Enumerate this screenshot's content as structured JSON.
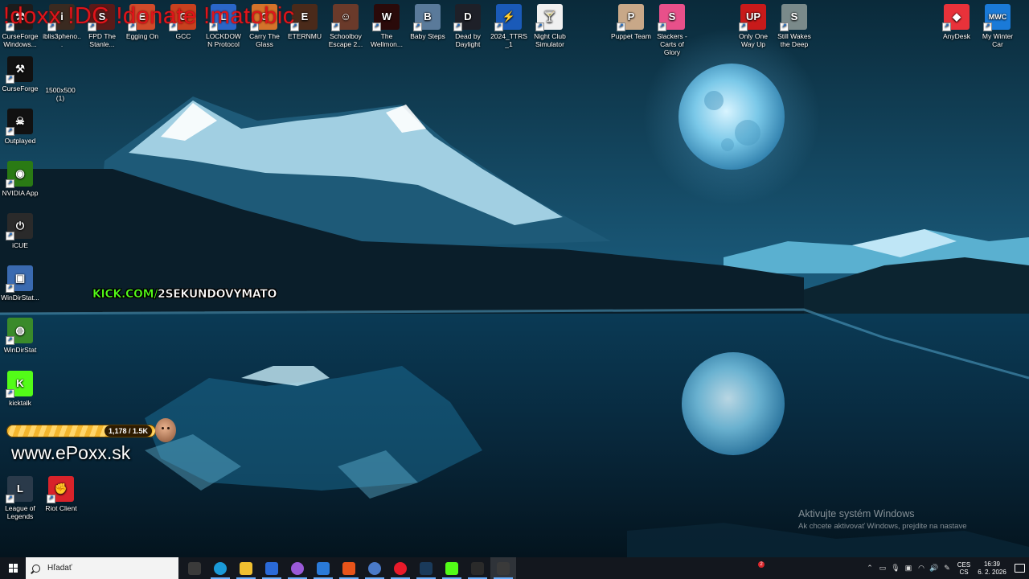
{
  "overlay": {
    "commands": "!doxx !DC !donate !matobic",
    "kick_prefix": "KICK.COM/",
    "kick_channel": "2SEKUNDOVYMATO",
    "sub_goal": "1,178 / 1.5K",
    "website": "www.ePoxx.sk"
  },
  "desktop": {
    "top_row": [
      {
        "label": "CurseForge Windows...",
        "color": "#1c1c1c",
        "glyph": "⚒",
        "name": "curseforge-windows-icon"
      },
      {
        "label": "iblis3pheno...",
        "color": "#3a2a20",
        "glyph": "i",
        "name": "iblis-icon"
      },
      {
        "label": "FPD The Stanle...",
        "color": "#5a1a18",
        "glyph": "S",
        "name": "stanley-parable-icon"
      },
      {
        "label": "Egging On",
        "color": "#d04a2a",
        "glyph": "E",
        "name": "egging-on-icon"
      },
      {
        "label": "GCC",
        "color": "#c8401e",
        "glyph": "G",
        "name": "gcc-icon"
      },
      {
        "label": "LOCKDOWN Protocol",
        "color": "#2a66c8",
        "glyph": "L",
        "name": "lockdown-protocol-icon"
      },
      {
        "label": "Carry The Glass",
        "color": "#d4732a",
        "glyph": "C",
        "name": "carry-the-glass-icon"
      },
      {
        "label": "ETERNMU",
        "color": "#4a2a1a",
        "glyph": "E",
        "name": "eternmu-icon"
      },
      {
        "label": "Schoolboy Escape 2...",
        "color": "#6a3a2a",
        "glyph": "☺",
        "name": "schoolboy-escape-icon"
      },
      {
        "label": "The Wellmon...",
        "color": "#2a0a0a",
        "glyph": "W",
        "name": "wellmonitor-icon"
      },
      {
        "label": "Baby Steps",
        "color": "#5a7a9a",
        "glyph": "B",
        "name": "baby-steps-icon"
      },
      {
        "label": "Dead by Daylight",
        "color": "#1e2028",
        "glyph": "D",
        "name": "dead-by-daylight-icon"
      },
      {
        "label": "2024_TTRS_1",
        "color": "#1a5ab8",
        "glyph": "⚡",
        "name": "ttrs-icon"
      },
      {
        "label": "Night Club Simulator",
        "color": "#f0f0f0",
        "glyph": "🍸",
        "name": "night-club-simulator-icon"
      },
      {
        "label": "Puppet Team",
        "color": "#c8a888",
        "glyph": "P",
        "name": "puppet-team-icon"
      },
      {
        "label": "Slackers - Carts of Glory",
        "color": "#e8508a",
        "glyph": "S",
        "name": "slackers-icon"
      },
      {
        "label": "Only One Way Up",
        "color": "#c81a1a",
        "glyph": "UP",
        "name": "only-one-way-up-icon"
      },
      {
        "label": "Still Wakes the Deep",
        "color": "#7a8a8a",
        "glyph": "S",
        "name": "still-wakes-the-deep-icon"
      },
      {
        "label": "AnyDesk",
        "color": "#e8323a",
        "glyph": "◆",
        "name": "anydesk-icon"
      },
      {
        "label": "My Winter Car",
        "color": "#1a7ad8",
        "glyph": "MWC",
        "name": "my-winter-car-icon"
      }
    ],
    "left_column": [
      {
        "label": "CurseForge",
        "color": "#111111",
        "glyph": "⚒",
        "name": "curseforge-icon"
      },
      {
        "label": "Outplayed",
        "color": "#111111",
        "glyph": "☠",
        "name": "outplayed-icon"
      },
      {
        "label": "NVIDIA App",
        "color": "#2a7a14",
        "glyph": "◉",
        "name": "nvidia-app-icon"
      },
      {
        "label": "iCUE",
        "color": "#2a2a2a",
        "glyph": "⏻",
        "name": "icue-icon"
      },
      {
        "label": "WinDirStat...",
        "color": "#3a6ab0",
        "glyph": "▣",
        "name": "windirstat-shortcut-icon"
      },
      {
        "label": "WinDirStat",
        "color": "#3a8a2a",
        "glyph": "◍",
        "name": "windirstat-icon"
      },
      {
        "label": "kicktalk",
        "color": "#53fc18",
        "glyph": "K",
        "name": "kicktalk-icon"
      },
      {
        "label": "League of Legends",
        "color": "#2a3a4a",
        "glyph": "L",
        "name": "league-of-legends-icon"
      },
      {
        "label": "Riot Client",
        "color": "#d8232a",
        "glyph": "✊",
        "name": "riot-client-icon"
      }
    ],
    "file_icon": {
      "label": "1500x500 (1)",
      "color": "#8a7a6a",
      "name": "image-file-icon"
    }
  },
  "watermark": {
    "title": "Aktivujte systém Windows",
    "subtitle": "Ak chcete aktivovať Windows, prejdite na nastave"
  },
  "taskbar": {
    "search_placeholder": "Hľadať",
    "apps": [
      {
        "name": "task-view-icon",
        "color": "#3a3a3a"
      },
      {
        "name": "edge-icon",
        "color": "#1a9ad8"
      },
      {
        "name": "file-explorer-icon",
        "color": "#f0c030"
      },
      {
        "name": "microsoft-store-icon",
        "color": "#2a6ad8"
      },
      {
        "name": "copilot-icon",
        "color": "#9a5ad8"
      },
      {
        "name": "mail-icon",
        "color": "#2a7ad8"
      },
      {
        "name": "brave-icon",
        "color": "#e8541a"
      },
      {
        "name": "app-icon",
        "color": "#4a7ac8"
      },
      {
        "name": "opera-icon",
        "color": "#e81a2a"
      },
      {
        "name": "steam-icon",
        "color": "#1a3a5a"
      },
      {
        "name": "kick-icon",
        "color": "#53fc18"
      },
      {
        "name": "obs-icon",
        "color": "#2a2a2a"
      },
      {
        "name": "recording-app-icon",
        "color": "#3a3a3a"
      }
    ],
    "notification_count": "2",
    "language": [
      "CES",
      "CS"
    ],
    "time": "16:39",
    "date": "6. 2. 2026"
  }
}
